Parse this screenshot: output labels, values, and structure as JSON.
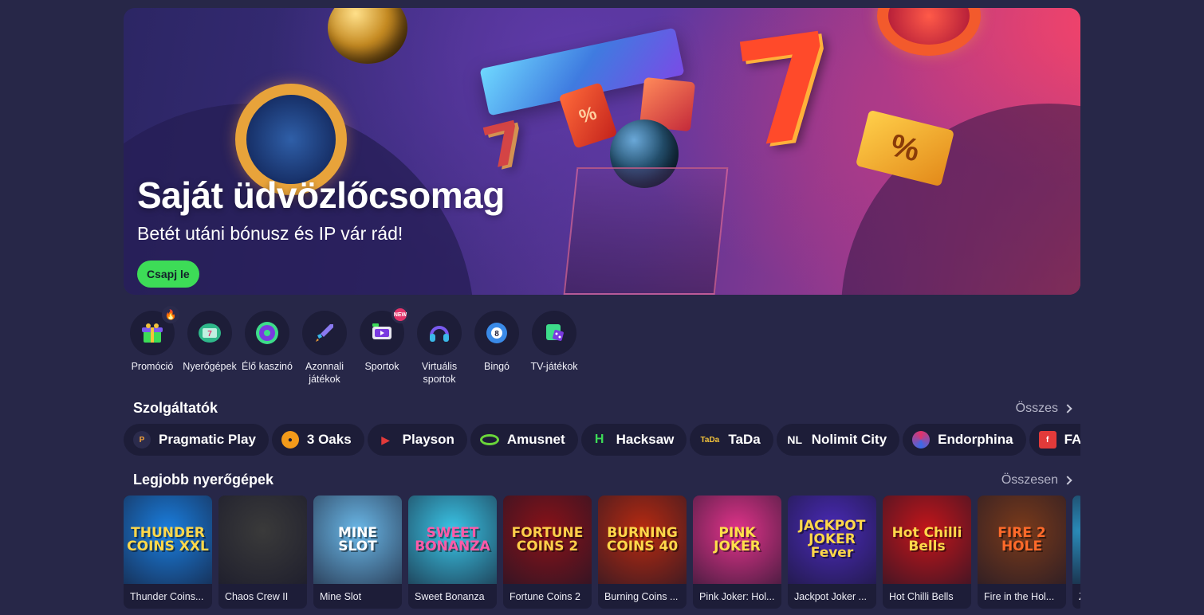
{
  "hero": {
    "title": "Saját üdvözlőcsomag",
    "subtitle": "Betét utáni bónusz és IP vár rád!",
    "cta_label": "Csapj le",
    "cta_color": "#3ddc57"
  },
  "categories": [
    {
      "label": "Promóció",
      "icon": "gift-icon",
      "badge": "fire"
    },
    {
      "label": "Nyerőgépek",
      "icon": "slot-machine-icon"
    },
    {
      "label": "Élő kaszinó",
      "icon": "roulette-icon"
    },
    {
      "label": "Azonnali játékok",
      "icon": "rocket-icon"
    },
    {
      "label": "Sportok",
      "icon": "tv-sport-icon",
      "badge": "NEW"
    },
    {
      "label": "Virtuális sportok",
      "icon": "headset-icon"
    },
    {
      "label": "Bingó",
      "icon": "bingo-ball-icon"
    },
    {
      "label": "TV-játékok",
      "icon": "tv-dice-icon"
    }
  ],
  "providers_section": {
    "title": "Szolgáltatók",
    "link": "Összes"
  },
  "providers": [
    {
      "name": "Pragmatic Play",
      "logo_color": "#f3a13a"
    },
    {
      "name": "3 Oaks",
      "logo_color": "#f39a1a"
    },
    {
      "name": "Playson",
      "logo_color": "#e23a3a"
    },
    {
      "name": "Amusnet",
      "logo_color": "#6ad63a"
    },
    {
      "name": "Hacksaw",
      "logo_color": "#3ddc57"
    },
    {
      "name": "TaDa",
      "logo_color": "#f3c33a"
    },
    {
      "name": "Nolimit City",
      "logo_color": "#ffffff"
    },
    {
      "name": "Endorphina",
      "logo_color": "#e2336a"
    },
    {
      "name": "FAZI",
      "logo_color": "#e23a3a"
    }
  ],
  "games_section": {
    "title": "Legjobb nyerőgépek",
    "link": "Összesen"
  },
  "games": [
    {
      "name": "Thunder Coins...",
      "art": "THUNDER COINS XXL",
      "bg": "#1a7fe0",
      "fg": "#ffd84a"
    },
    {
      "name": "Chaos Crew II",
      "art": "",
      "bg": "#3a3a3a",
      "fg": "#8ae05a"
    },
    {
      "name": "Mine Slot",
      "art": "MINE SLOT",
      "bg": "#6ab8e8",
      "fg": "#ffffff"
    },
    {
      "name": "Sweet Bonanza",
      "art": "SWEET BONANZA",
      "bg": "#3ac6e8",
      "fg": "#ff5aa8"
    },
    {
      "name": "Fortune Coins 2",
      "art": "FORTUNE COINS 2",
      "bg": "#8a1218",
      "fg": "#ffcf4a"
    },
    {
      "name": "Burning Coins ...",
      "art": "BURNING COINS 40",
      "bg": "#b82a10",
      "fg": "#ffd84a"
    },
    {
      "name": "Pink Joker: Hol...",
      "art": "PINK JOKER",
      "bg": "#e2338a",
      "fg": "#ffe04a"
    },
    {
      "name": "Jackpot Joker ...",
      "art": "JACKPOT JOKER Fever",
      "bg": "#4a2ab8",
      "fg": "#ffd84a"
    },
    {
      "name": "Hot Chilli Bells",
      "art": "Hot Chilli Bells",
      "bg": "#c4151a",
      "fg": "#ffd84a"
    },
    {
      "name": "Fire in the Hol...",
      "art": "FIRE 2 HOLE",
      "bg": "#7a3a1a",
      "fg": "#ff6a2a"
    },
    {
      "name": "Z",
      "art": "",
      "bg": "#2a8ab8",
      "fg": "#ffffff"
    }
  ]
}
